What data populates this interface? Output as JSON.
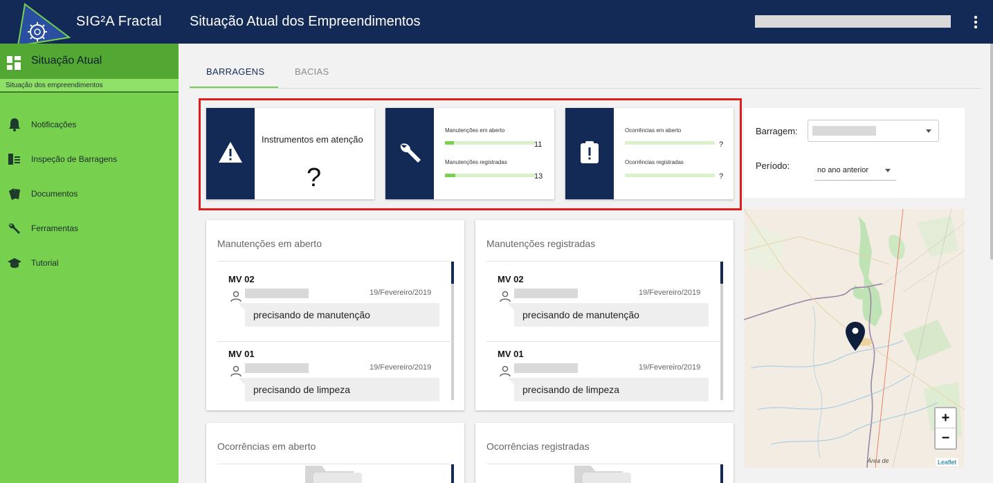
{
  "header": {
    "app_name": "SIG²A Fractal",
    "page_title": "Situação Atual dos Empreendimentos",
    "bg_color": "#132a56"
  },
  "sidebar": {
    "active": {
      "label": "Situação Atual",
      "sub_label": "Situação dos empreendimentos"
    },
    "items": [
      {
        "label": "Notificações",
        "icon": "bell-icon"
      },
      {
        "label": "Inspeção de Barragens",
        "icon": "inspection-icon"
      },
      {
        "label": "Documentos",
        "icon": "documents-icon"
      },
      {
        "label": "Ferramentas",
        "icon": "wrench-icon"
      },
      {
        "label": "Tutorial",
        "icon": "graduation-cap-icon"
      }
    ],
    "bg_color": "#78d14e"
  },
  "tabs": [
    {
      "label": "BARRAGENS",
      "active": true
    },
    {
      "label": "BACIAS",
      "active": false
    }
  ],
  "kpis": {
    "instrumentos": {
      "title": "Instrumentos em atenção",
      "value": "?"
    },
    "manutencoes": {
      "open_label": "Manutenções em aberto",
      "open_value": "11",
      "registered_label": "Manutenções registradas",
      "registered_value": "13"
    },
    "ocorrencias": {
      "open_label": "Ocorrências em aberto",
      "open_value": "?",
      "registered_label": "Ocorrências registradas",
      "registered_value": "?"
    }
  },
  "lists": {
    "manut_aberto": {
      "title": "Manutenções em aberto",
      "entries": [
        {
          "title": "MV 02",
          "date": "19/Fevereiro/2019",
          "message": "precisando de manutenção"
        },
        {
          "title": "MV 01",
          "date": "19/Fevereiro/2019",
          "message": "precisando de limpeza"
        }
      ]
    },
    "manut_registradas": {
      "title": "Manutenções registradas",
      "entries": [
        {
          "title": "MV 02",
          "date": "19/Fevereiro/2019",
          "message": "precisando de manutenção"
        },
        {
          "title": "MV 01",
          "date": "19/Fevereiro/2019",
          "message": "precisando de limpeza"
        }
      ]
    },
    "ocorr_aberto": {
      "title": "Ocorrências em aberto"
    },
    "ocorr_registradas": {
      "title": "Ocorrências registradas"
    }
  },
  "filters": {
    "barragem_label": "Barragem:",
    "periodo_label": "Período:",
    "periodo_value": "no ano anterior"
  },
  "map": {
    "zoom_in": "+",
    "zoom_out": "−",
    "attribution": "Leaflet",
    "label_area": "Área de"
  }
}
